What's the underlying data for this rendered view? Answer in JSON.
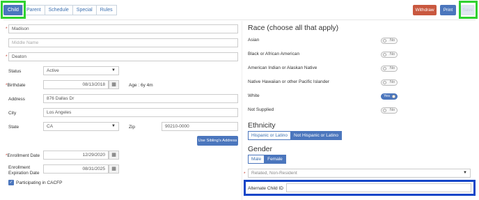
{
  "tabs": [
    "Child",
    "Parent",
    "Schedule",
    "Special",
    "Rules"
  ],
  "header_buttons": {
    "withdraw": "Withdraw",
    "print": "Print",
    "save": "Save"
  },
  "left": {
    "first_name": "Madison",
    "middle_name_placeholder": "Middle Name",
    "last_name": "Deaton",
    "status_label": "Status",
    "status_value": "Active",
    "birthdate_label": "Birthdate",
    "birthdate_value": "08/13/2018",
    "age_text": "Age : 6y 4m",
    "address_label": "Address",
    "address_value": "876 Dallas Dr",
    "city_label": "City",
    "city_value": "Los Angeles",
    "state_label": "State",
    "state_value": "CA",
    "zip_label": "Zip",
    "zip_value": "90210-0000",
    "siblings_button": "Use Sibling's Address",
    "enroll_label": "Enrollment Date",
    "enroll_value": "12/29/2020",
    "exp_label_1": "Enrollment",
    "exp_label_2": "Expiration Date",
    "exp_value": "08/31/2025",
    "cacfp_label": "Participating in CACFP"
  },
  "right": {
    "race_title": "Race (choose all that apply)",
    "races": [
      {
        "label": "Asian",
        "state": "No"
      },
      {
        "label": "Black or African American",
        "state": "No"
      },
      {
        "label": "American Indian or Alaskan Native",
        "state": "No"
      },
      {
        "label": "Native Hawaiian or other Pacific Islander",
        "state": "No"
      },
      {
        "label": "White",
        "state": "Yes"
      },
      {
        "label": "Not Supplied",
        "state": "No"
      }
    ],
    "ethnicity_title": "Ethnicity",
    "ethnicity_options": [
      "Hispanic or Latino",
      "Not Hispanic or Latino"
    ],
    "ethnicity_selected": "Not Hispanic or Latino",
    "gender_title": "Gender",
    "gender_options": [
      "Male",
      "Female"
    ],
    "gender_selected": "Female",
    "relation_value": "Related, Non-Resident",
    "alt_id_label": "Alternate Child ID"
  },
  "colors": {
    "primary": "#4b76bd",
    "withdraw": "#c9583f",
    "highlight_green": "#2fd12f",
    "highlight_blue": "#1446c8"
  }
}
